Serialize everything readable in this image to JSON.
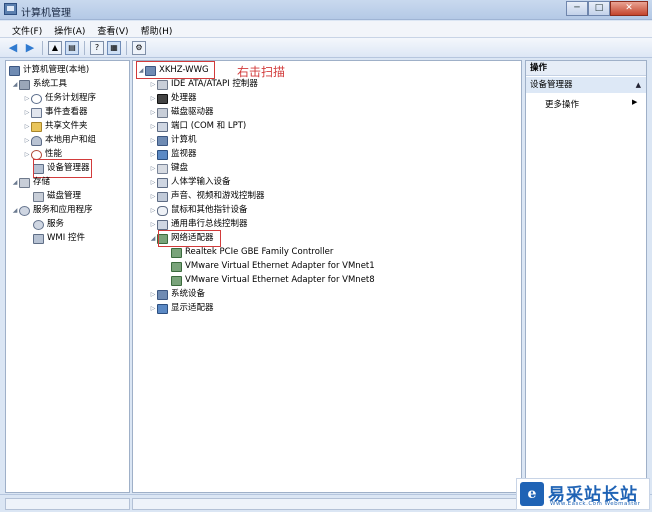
{
  "window": {
    "title": "计算机管理",
    "buttons": {
      "minimize": "─",
      "maximize": "□",
      "close": "✕"
    }
  },
  "menubar": [
    "文件(F)",
    "操作(A)",
    "查看(V)",
    "帮助(H)"
  ],
  "left_tree": {
    "root": "计算机管理(本地)",
    "system_tools": "系统工具",
    "task_scheduler": "任务计划程序",
    "event_viewer": "事件查看器",
    "shared_folders": "共享文件夹",
    "local_users": "本地用户和组",
    "performance": "性能",
    "device_manager": "设备管理器",
    "storage": "存储",
    "disk_management": "磁盘管理",
    "services_apps": "服务和应用程序",
    "services": "服务",
    "wmi": "WMI 控件"
  },
  "device_tree": {
    "host": "XKHZ-WWG",
    "annotation": "右击扫描",
    "categories": [
      "IDE ATA/ATAPI 控制器",
      "处理器",
      "磁盘驱动器",
      "端口 (COM 和 LPT)",
      "计算机",
      "监视器",
      "键盘",
      "人体学输入设备",
      "声音、视频和游戏控制器",
      "鼠标和其他指针设备",
      "通用串行总线控制器",
      "网络适配器"
    ],
    "network_adapters": [
      "Realtek PCIe GBE Family Controller",
      "VMware Virtual Ethernet Adapter for VMnet1",
      "VMware Virtual Ethernet Adapter for VMnet8"
    ],
    "after": [
      "系统设备",
      "显示适配器"
    ]
  },
  "actions": {
    "header": "操作",
    "section": "设备管理器",
    "more": "更多操作"
  },
  "watermark": {
    "text": "易采站长站",
    "url": "Www.Easck.Com Webmaster",
    "logo": "e"
  }
}
